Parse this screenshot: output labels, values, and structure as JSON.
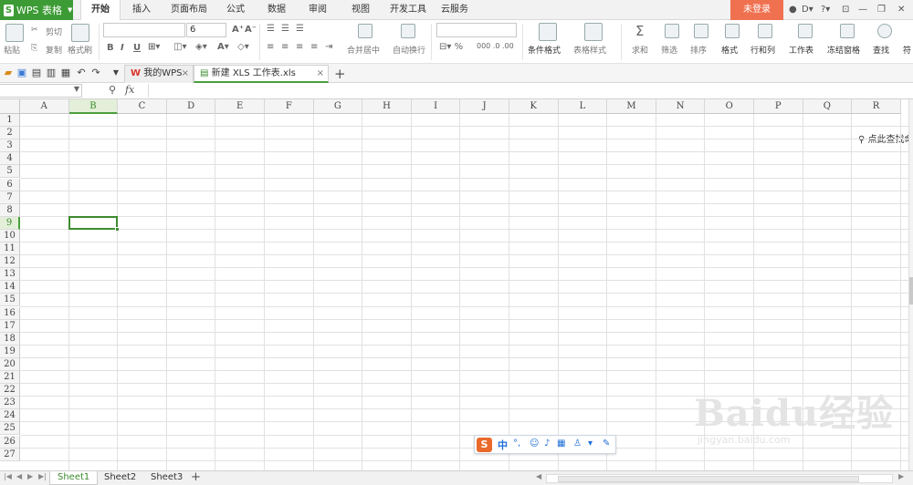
{
  "app": {
    "logo_text": "WPS 表格",
    "login": "未登录"
  },
  "ribbon_tabs": [
    {
      "label": "开始",
      "active": true
    },
    {
      "label": "插入"
    },
    {
      "label": "页面布局"
    },
    {
      "label": "公式"
    },
    {
      "label": "数据"
    },
    {
      "label": "审阅"
    },
    {
      "label": "视图"
    },
    {
      "label": "开发工具"
    },
    {
      "label": "云服务"
    }
  ],
  "ribbon": {
    "paste": "粘贴",
    "cut": "剪切",
    "copy": "复制",
    "format_painter": "格式刷",
    "font_size": "6",
    "bold": "B",
    "italic": "I",
    "underline": "U",
    "merge_center": "合并居中",
    "wrap_text": "自动换行",
    "cond_format": "条件格式",
    "table_style": "表格样式",
    "sum": "求和",
    "filter": "筛选",
    "sort": "排序",
    "format": "格式",
    "row_col": "行和列",
    "worksheet": "工作表",
    "freeze": "冻结窗格",
    "find": "查找",
    "find_more": "符"
  },
  "doc_tabs": [
    {
      "label": "我的WPS"
    },
    {
      "label": "新建 XLS 工作表.xls",
      "active": true
    }
  ],
  "find_command": "点此查找命令",
  "formula_bar": {
    "name_box": "",
    "fx": "fx"
  },
  "columns": [
    "A",
    "B",
    "C",
    "D",
    "E",
    "F",
    "G",
    "H",
    "I",
    "J",
    "K",
    "L",
    "M",
    "N",
    "O",
    "P",
    "Q",
    "R"
  ],
  "rows": [
    "1",
    "2",
    "3",
    "4",
    "5",
    "6",
    "7",
    "8",
    "9",
    "10",
    "11",
    "12",
    "13",
    "14",
    "15",
    "16",
    "17",
    "18",
    "19",
    "20",
    "21",
    "22",
    "23",
    "24",
    "25",
    "26",
    "27"
  ],
  "selected": {
    "column": "B",
    "row": "9"
  },
  "sheets": [
    {
      "label": "Sheet1",
      "active": true
    },
    {
      "label": "Sheet2"
    },
    {
      "label": "Sheet3"
    }
  ],
  "ime": {
    "logo": "S",
    "mode": "中"
  },
  "watermark": {
    "brand": "Baidu经验",
    "url": "jingyan.baidu.com"
  },
  "colors": {
    "accent": "#3d9b35",
    "login": "#ef7150",
    "selection": "#3d8b2e"
  }
}
